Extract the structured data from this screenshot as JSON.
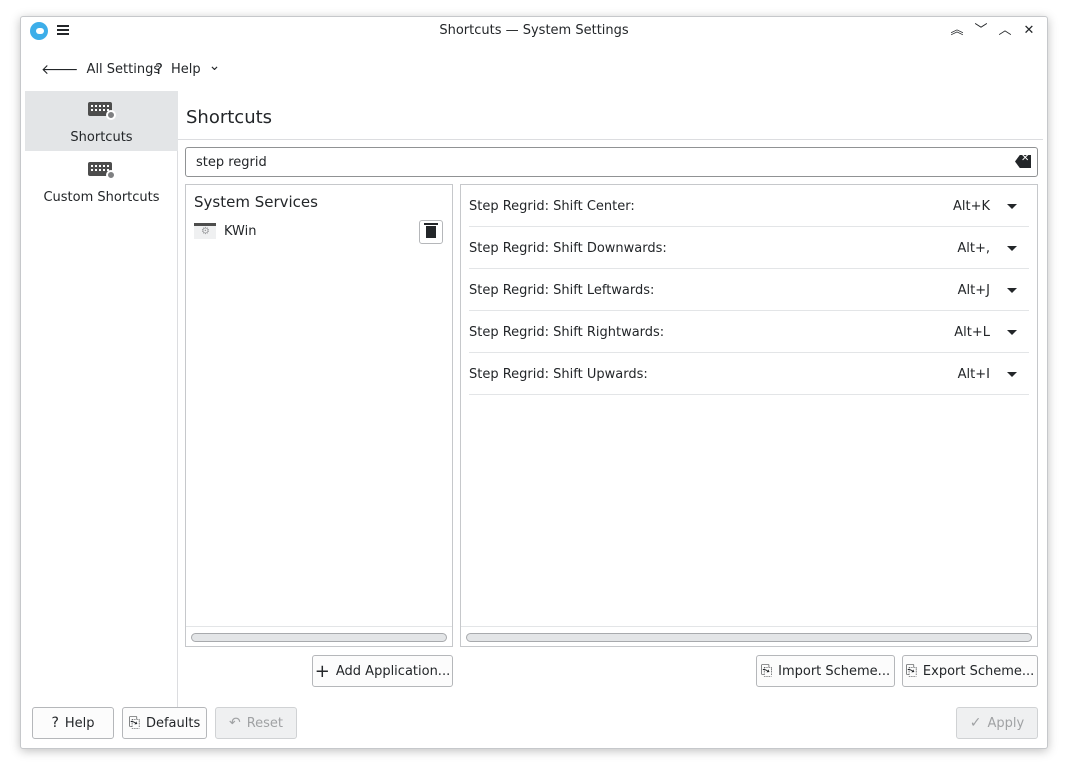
{
  "window": {
    "title": "Shortcuts — System Settings",
    "controls": {
      "keep_above": "︽",
      "minimize": "﹀",
      "maximize": "︿",
      "close": "✕"
    }
  },
  "toolbar": {
    "back_label": "All Settings",
    "help_label": "Help",
    "help_icon": "?",
    "back_icon": "🡐",
    "chevron": "⌄"
  },
  "sidebar": {
    "items": [
      {
        "label": "Shortcuts",
        "active": true
      },
      {
        "label": "Custom Shortcuts",
        "active": false
      }
    ]
  },
  "page": {
    "title": "Shortcuts"
  },
  "search": {
    "value": "step regrid"
  },
  "left_panel": {
    "heading": "System Services",
    "items": [
      {
        "label": "KWin"
      }
    ]
  },
  "shortcuts": [
    {
      "label": "Step Regrid: Shift Center:",
      "keys": "Alt+K"
    },
    {
      "label": "Step Regrid: Shift Downwards:",
      "keys": "Alt+,"
    },
    {
      "label": "Step Regrid: Shift Leftwards:",
      "keys": "Alt+J"
    },
    {
      "label": "Step Regrid: Shift Rightwards:",
      "keys": "Alt+L"
    },
    {
      "label": "Step Regrid: Shift Upwards:",
      "keys": "Alt+I"
    }
  ],
  "buttons": {
    "add_application": "Add Application...",
    "import_scheme": "Import Scheme...",
    "export_scheme": "Export Scheme...",
    "help": "Help",
    "defaults": "Defaults",
    "reset": "Reset",
    "apply": "Apply"
  },
  "colors": {
    "accent": "#3daee9",
    "sidebar_active": "#e3e5e7"
  }
}
